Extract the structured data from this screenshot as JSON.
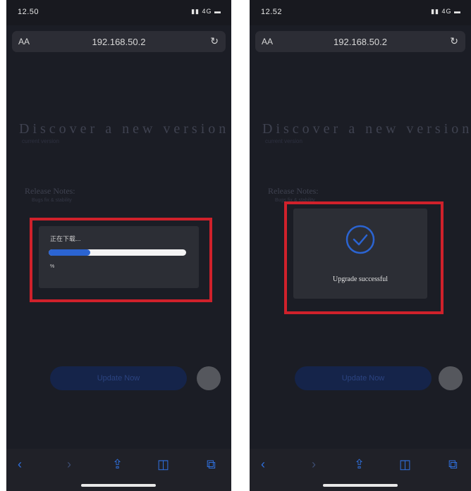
{
  "screens": [
    {
      "status_time": "12.50",
      "status_signal": "▮▮ 4G ▬",
      "url_aa": "AA",
      "url": "192.168.50.2",
      "heading": "Discover a new version",
      "subheading": "current version",
      "release_title": "Release Notes:",
      "release_sub": "Bugs fix & stability",
      "dialog_title": "正在下载...",
      "progress_percent": 30,
      "progress_label": "%",
      "update_label": "Update Now"
    },
    {
      "status_time": "12.52",
      "status_signal": "▮▮ 4G ▬",
      "url_aa": "AA",
      "url": "192.168.50.2",
      "heading": "Discover a new version",
      "subheading": "current version",
      "release_title": "Release Notes:",
      "release_sub": "Bugs fix & stability",
      "success_message": "Upgrade successful",
      "update_label": "Update Now"
    }
  ],
  "icons": {
    "reload": "reload-icon",
    "back": "back-icon",
    "forward": "forward-icon",
    "share": "share-icon",
    "bookmarks": "bookmarks-icon",
    "tabs": "tabs-icon",
    "success": "check-circle-icon"
  },
  "colors": {
    "highlight_box": "#d0212b",
    "accent": "#2b64d2",
    "background": "#1b1d25"
  }
}
